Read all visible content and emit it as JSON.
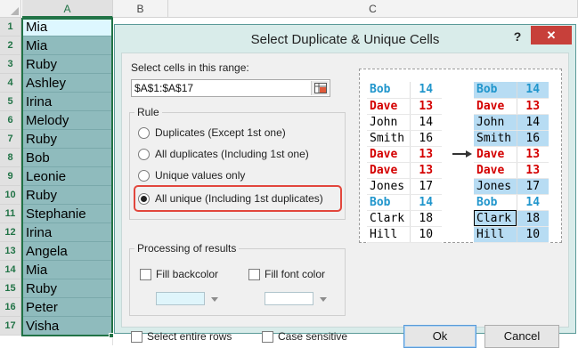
{
  "sheet": {
    "columns": [
      "A",
      "B",
      "C"
    ],
    "rows": [
      "1",
      "2",
      "3",
      "4",
      "5",
      "6",
      "7",
      "8",
      "9",
      "10",
      "11",
      "12",
      "13",
      "14",
      "15",
      "16",
      "17"
    ],
    "cells": [
      "Mia",
      "Mia",
      "Ruby",
      "Ashley",
      "Irina",
      "Melody",
      "Ruby",
      "Bob",
      "Leonie",
      "Ruby",
      "Stephanie",
      "Irina",
      "Angela",
      "Mia",
      "Ruby",
      "Peter",
      "Visha"
    ]
  },
  "dialog": {
    "title": "Select Duplicate & Unique Cells",
    "help": "?",
    "close": "✕",
    "range_label": "Select cells in this range:",
    "range_value": "$A$1:$A$17",
    "rule_legend": "Rule",
    "rules": [
      {
        "label": "Duplicates (Except 1st one)",
        "selected": false
      },
      {
        "label": "All duplicates (Including 1st one)",
        "selected": false
      },
      {
        "label": "Unique values only",
        "selected": false
      },
      {
        "label": "All unique (Including 1st duplicates)",
        "selected": true
      }
    ],
    "processing_legend": "Processing of results",
    "fill_backcolor": "Fill backcolor",
    "fill_font_color": "Fill font color",
    "select_entire_rows": "Select entire rows",
    "case_sensitive": "Case sensitive",
    "ok": "Ok",
    "cancel": "Cancel",
    "colors": {
      "accent_border": "#e2463c",
      "swatch": "#dff5fb",
      "highlight": "#b7dcf3",
      "dup_red": "#d40000",
      "dup_blue": "#2196cc"
    }
  },
  "preview": {
    "left": [
      {
        "name": "Bob",
        "num": "14",
        "style": "blue"
      },
      {
        "name": "Dave",
        "num": "13",
        "style": "red"
      },
      {
        "name": "John",
        "num": "14",
        "style": "blk"
      },
      {
        "name": "Smith",
        "num": "16",
        "style": "blk"
      },
      {
        "name": "Dave",
        "num": "13",
        "style": "red"
      },
      {
        "name": "Dave",
        "num": "13",
        "style": "red"
      },
      {
        "name": "Jones",
        "num": "17",
        "style": "blk"
      },
      {
        "name": "Bob",
        "num": "14",
        "style": "blue"
      },
      {
        "name": "Clark",
        "num": "18",
        "style": "blk"
      },
      {
        "name": "Hill",
        "num": "10",
        "style": "blk"
      }
    ],
    "right": [
      {
        "name": "Bob",
        "num": "14",
        "style": "blue",
        "hl": true
      },
      {
        "name": "Dave",
        "num": "13",
        "style": "red",
        "hl": false
      },
      {
        "name": "John",
        "num": "14",
        "style": "blk",
        "hl": true
      },
      {
        "name": "Smith",
        "num": "16",
        "style": "blk",
        "hl": true
      },
      {
        "name": "Dave",
        "num": "13",
        "style": "red",
        "hl": false
      },
      {
        "name": "Dave",
        "num": "13",
        "style": "red",
        "hl": false
      },
      {
        "name": "Jones",
        "num": "17",
        "style": "blk",
        "hl": true
      },
      {
        "name": "Bob",
        "num": "14",
        "style": "blue",
        "hl": false
      },
      {
        "name": "Clark",
        "num": "18",
        "style": "blk",
        "hl": true
      },
      {
        "name": "Hill",
        "num": "10",
        "style": "blk",
        "hl": true
      }
    ]
  }
}
